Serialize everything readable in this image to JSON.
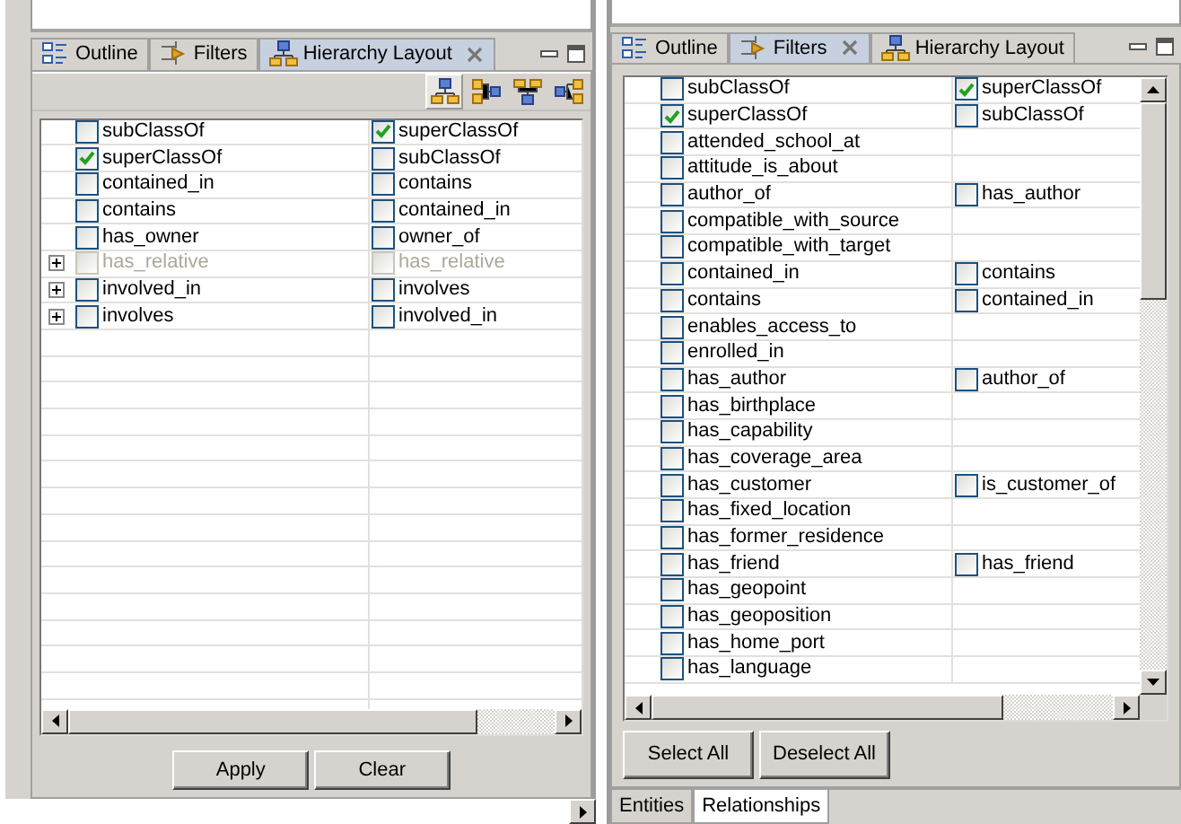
{
  "left_view": {
    "tabs": [
      {
        "label": "Outline",
        "kind": "outline",
        "selected": false,
        "closable": false
      },
      {
        "label": "Filters",
        "kind": "filters",
        "selected": false,
        "closable": false
      },
      {
        "label": "Hierarchy Layout",
        "kind": "hierarchy",
        "selected": true,
        "closable": true
      }
    ],
    "toolbar": [
      {
        "kind": "top-down",
        "selected": true
      },
      {
        "kind": "left-right",
        "selected": false
      },
      {
        "kind": "bottom-up",
        "selected": false
      },
      {
        "kind": "right-left",
        "selected": false
      }
    ],
    "rows": [
      {
        "expandable": false,
        "disabled": false,
        "left": {
          "label": "subClassOf",
          "checked": false
        },
        "right": {
          "label": "superClassOf",
          "checked": true
        }
      },
      {
        "expandable": false,
        "disabled": false,
        "left": {
          "label": "superClassOf",
          "checked": true
        },
        "right": {
          "label": "subClassOf",
          "checked": false
        }
      },
      {
        "expandable": false,
        "disabled": false,
        "left": {
          "label": "contained_in",
          "checked": false
        },
        "right": {
          "label": "contains",
          "checked": false
        }
      },
      {
        "expandable": false,
        "disabled": false,
        "left": {
          "label": "contains",
          "checked": false
        },
        "right": {
          "label": "contained_in",
          "checked": false
        }
      },
      {
        "expandable": false,
        "disabled": false,
        "left": {
          "label": "has_owner",
          "checked": false
        },
        "right": {
          "label": "owner_of",
          "checked": false
        }
      },
      {
        "expandable": true,
        "disabled": true,
        "left": {
          "label": "has_relative",
          "checked": false
        },
        "right": {
          "label": "has_relative",
          "checked": false
        }
      },
      {
        "expandable": true,
        "disabled": false,
        "left": {
          "label": "involved_in",
          "checked": false
        },
        "right": {
          "label": "involves",
          "checked": false
        }
      },
      {
        "expandable": true,
        "disabled": false,
        "left": {
          "label": "involves",
          "checked": false
        },
        "right": {
          "label": "involved_in",
          "checked": false
        }
      }
    ],
    "buttons": [
      "Apply",
      "Clear"
    ]
  },
  "right_view": {
    "tabs": [
      {
        "label": "Outline",
        "kind": "outline",
        "selected": false,
        "closable": false
      },
      {
        "label": "Filters",
        "kind": "filters",
        "selected": true,
        "closable": true
      },
      {
        "label": "Hierarchy Layout",
        "kind": "hierarchy",
        "selected": false,
        "closable": false
      }
    ],
    "rows": [
      {
        "left": {
          "label": "subClassOf",
          "checked": false
        },
        "right": {
          "label": "superClassOf",
          "checked": true
        }
      },
      {
        "left": {
          "label": "superClassOf",
          "checked": true
        },
        "right": {
          "label": "subClassOf",
          "checked": false
        }
      },
      {
        "left": {
          "label": "attended_school_at",
          "checked": false
        }
      },
      {
        "left": {
          "label": "attitude_is_about",
          "checked": false
        }
      },
      {
        "left": {
          "label": "author_of",
          "checked": false
        },
        "right": {
          "label": "has_author",
          "checked": false
        }
      },
      {
        "left": {
          "label": "compatible_with_source",
          "checked": false
        }
      },
      {
        "left": {
          "label": "compatible_with_target",
          "checked": false
        }
      },
      {
        "left": {
          "label": "contained_in",
          "checked": false
        },
        "right": {
          "label": "contains",
          "checked": false
        }
      },
      {
        "left": {
          "label": "contains",
          "checked": false
        },
        "right": {
          "label": "contained_in",
          "checked": false
        }
      },
      {
        "left": {
          "label": "enables_access_to",
          "checked": false
        }
      },
      {
        "left": {
          "label": "enrolled_in",
          "checked": false
        }
      },
      {
        "left": {
          "label": "has_author",
          "checked": false
        },
        "right": {
          "label": "author_of",
          "checked": false
        }
      },
      {
        "left": {
          "label": "has_birthplace",
          "checked": false
        }
      },
      {
        "left": {
          "label": "has_capability",
          "checked": false
        }
      },
      {
        "left": {
          "label": "has_coverage_area",
          "checked": false
        }
      },
      {
        "left": {
          "label": "has_customer",
          "checked": false
        },
        "right": {
          "label": "is_customer_of",
          "checked": false
        }
      },
      {
        "left": {
          "label": "has_fixed_location",
          "checked": false
        }
      },
      {
        "left": {
          "label": "has_former_residence",
          "checked": false
        }
      },
      {
        "left": {
          "label": "has_friend",
          "checked": false
        },
        "right": {
          "label": "has_friend",
          "checked": false
        }
      },
      {
        "left": {
          "label": "has_geopoint",
          "checked": false
        }
      },
      {
        "left": {
          "label": "has_geoposition",
          "checked": false
        }
      },
      {
        "left": {
          "label": "has_home_port",
          "checked": false
        }
      },
      {
        "left": {
          "label": "has_language",
          "checked": false
        }
      }
    ],
    "buttons": [
      "Select All",
      "Deselect All"
    ],
    "bottom_tabs": [
      {
        "label": "Entities",
        "selected": false
      },
      {
        "label": "Relationships",
        "selected": true
      }
    ]
  }
}
